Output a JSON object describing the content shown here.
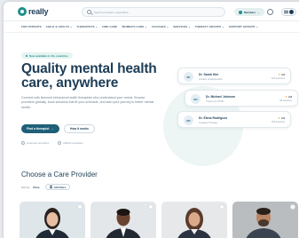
{
  "header": {
    "logo_text": "really",
    "search_placeholder": "Search providers, specialties...",
    "member_label": "Members",
    "chevron": "⌄"
  },
  "nav": {
    "items": [
      "FOR PATIENTS",
      "CHILD & ADULTS ⌄",
      "THERAPISTS ⌄",
      "FIND CARE",
      "WOMEN'S CARE ⌄",
      "COACHES ⌄",
      "SERVICES ⌄",
      "THERAPY GROUPS ⌄",
      "SUPPORT GROUPS ⌄"
    ]
  },
  "hero": {
    "badge": "Now available in 40+ countries",
    "title": "Quality mental health care, anywhere",
    "description": "Connect with licensed behavioral health therapists who understand your needs. Browse providers globally, book sessions that fit your schedule, and start your journey to better mental health.",
    "primary_button": "Find a therapist",
    "primary_arrow": "→",
    "secondary_button": "How it works",
    "trust": [
      "Licensed providers",
      "HIPAA compliant"
    ]
  },
  "providers_preview": [
    {
      "initials": "SK",
      "name": "Dr. Sarah Kim",
      "specialty": "Anxiety & Depression",
      "rating": "4.9",
      "sessions": "120 sessions"
    },
    {
      "initials": "MJ",
      "name": "Dr. Michael Johnson",
      "specialty": "Trauma & PTSD",
      "rating": "4.8",
      "sessions": "98 sessions"
    },
    {
      "initials": "ER",
      "name": "Dr. Elena Rodriguez",
      "specialty": "Couples Therapy",
      "rating": "4.9",
      "sessions": "150 sessions"
    }
  ],
  "icons": {
    "star": "★"
  },
  "section": {
    "title": "Choose a Care Provider",
    "sort_label": "Sort by:",
    "sort_value": "Price",
    "filter_button": "All Filters"
  },
  "colors": {
    "primary": "#1d3d57",
    "accent": "#1f8f8a",
    "button": "#1f5f78",
    "star": "#f0a53a"
  }
}
